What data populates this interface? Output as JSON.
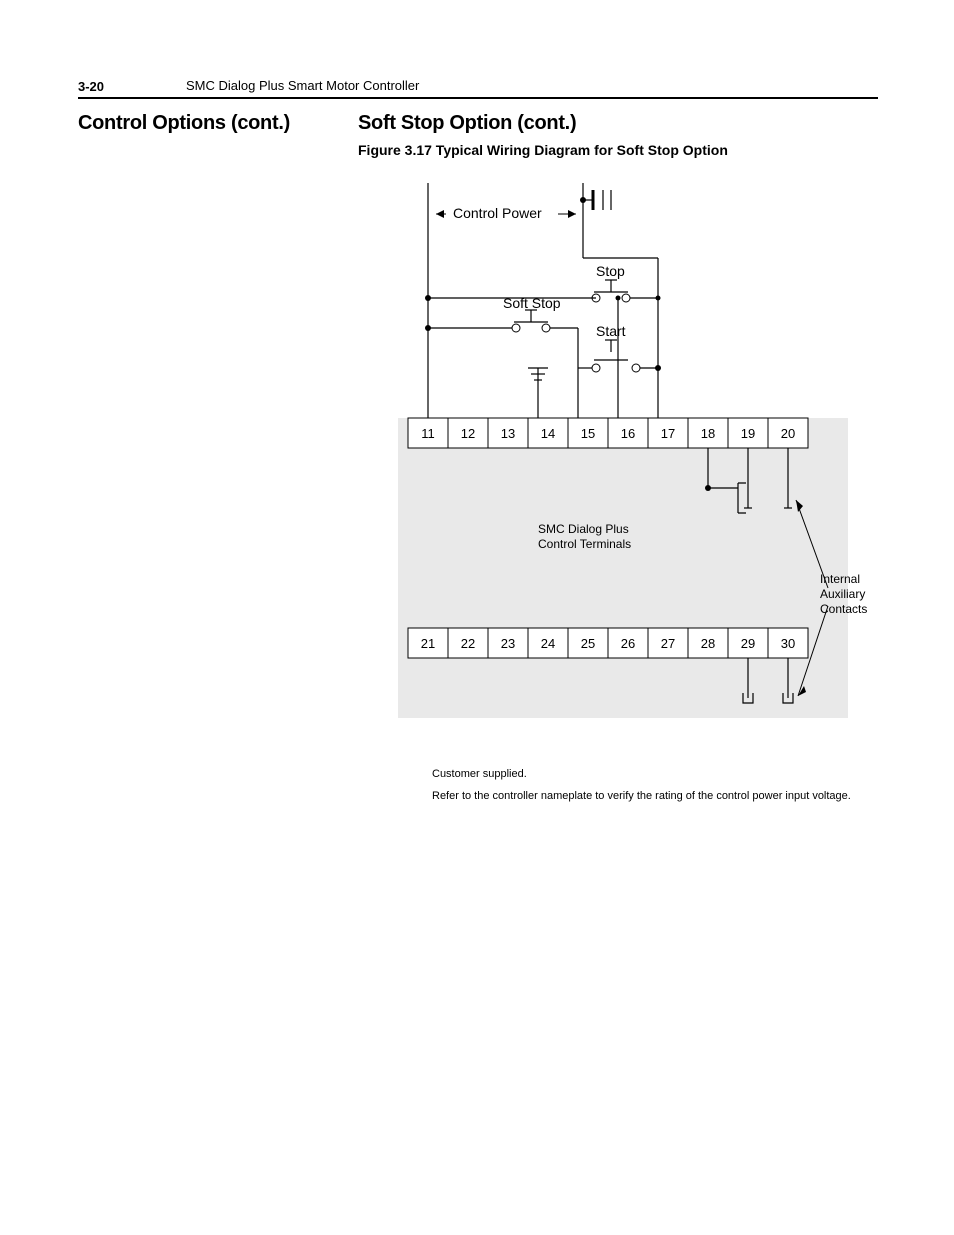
{
  "header": {
    "page_number": "3-20",
    "doc_title": "SMC Dialog Plus Smart Motor Controller"
  },
  "headings": {
    "left": "Control Options (cont.)",
    "right": "Soft Stop Option (cont.)"
  },
  "figure_caption": "Figure 3.17 Typical Wiring Diagram for Soft Stop Option",
  "diagram": {
    "labels": {
      "control_power": "Control Power",
      "stop": "Stop",
      "soft_stop": "Soft Stop",
      "start": "Start",
      "block_label_1": "SMC Dialog Plus",
      "block_label_2": "Control Terminals",
      "aux_1": "Internal",
      "aux_2": "Auxiliary",
      "aux_3": "Contacts"
    },
    "terminals_top": [
      "11",
      "12",
      "13",
      "14",
      "15",
      "16",
      "17",
      "18",
      "19",
      "20"
    ],
    "terminals_bottom": [
      "21",
      "22",
      "23",
      "24",
      "25",
      "26",
      "27",
      "28",
      "29",
      "30"
    ]
  },
  "footnotes": {
    "a": "Customer supplied.",
    "b": "Refer to the controller nameplate to verify the rating of the control power input voltage."
  }
}
